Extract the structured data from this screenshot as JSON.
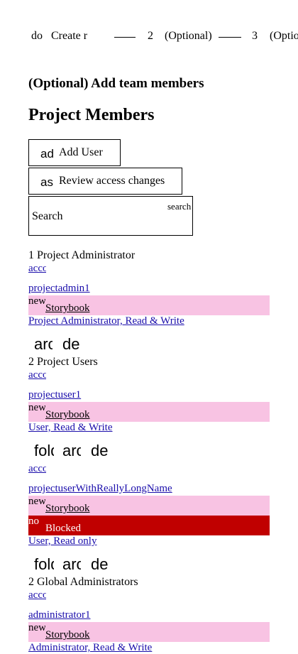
{
  "stepper": {
    "step1_icon": "do",
    "step1_label": "Create r",
    "step2_number": "2",
    "step2_label": "(Optional)",
    "step3_number": "3",
    "step3_label": "(Option"
  },
  "page": {
    "subtitle": "(Optional) Add team members",
    "title": "Project Members"
  },
  "toolbar": {
    "add_icon": "add",
    "add_label": "Add User",
    "review_icon": "assignment",
    "review_label": "Review access changes"
  },
  "search": {
    "placeholder": "Search",
    "icon_text": "search"
  },
  "groups": [
    {
      "title": "1 Project Administrator",
      "members": [
        {
          "access_icon": "account_circle",
          "username": "projectadmin1",
          "tags": [
            {
              "icon": "new",
              "label": "Storybook",
              "style": "pink"
            }
          ],
          "role": "Project Administrator, Read & Write",
          "actions": [
            "archive",
            "delete"
          ]
        }
      ]
    },
    {
      "title": "2 Project Users",
      "members": [
        {
          "access_icon": "account_circle",
          "username": "projectuser1",
          "tags": [
            {
              "icon": "new",
              "label": "Storybook",
              "style": "pink"
            }
          ],
          "role": "User, Read & Write",
          "actions": [
            "folder",
            "archive",
            "delete"
          ]
        },
        {
          "access_icon": "account_circle",
          "username": "projectuserWithReallyLongName",
          "tags": [
            {
              "icon": "new",
              "label": "Storybook",
              "style": "pink"
            },
            {
              "icon": "no",
              "label": "Blocked",
              "style": "red"
            }
          ],
          "role": "User, Read only",
          "actions": [
            "folder",
            "archive",
            "delete"
          ]
        }
      ]
    },
    {
      "title": "2 Global Administrators",
      "members": [
        {
          "access_icon": "account_circle",
          "username": "administrator1",
          "tags": [
            {
              "icon": "new",
              "label": "Storybook",
              "style": "pink"
            }
          ],
          "role": "Administrator, Read & Write",
          "actions": []
        }
      ]
    }
  ],
  "colors": {
    "tag_pink": "#f8c3e3",
    "tag_red": "#c00000",
    "link": "#1a0dab"
  }
}
